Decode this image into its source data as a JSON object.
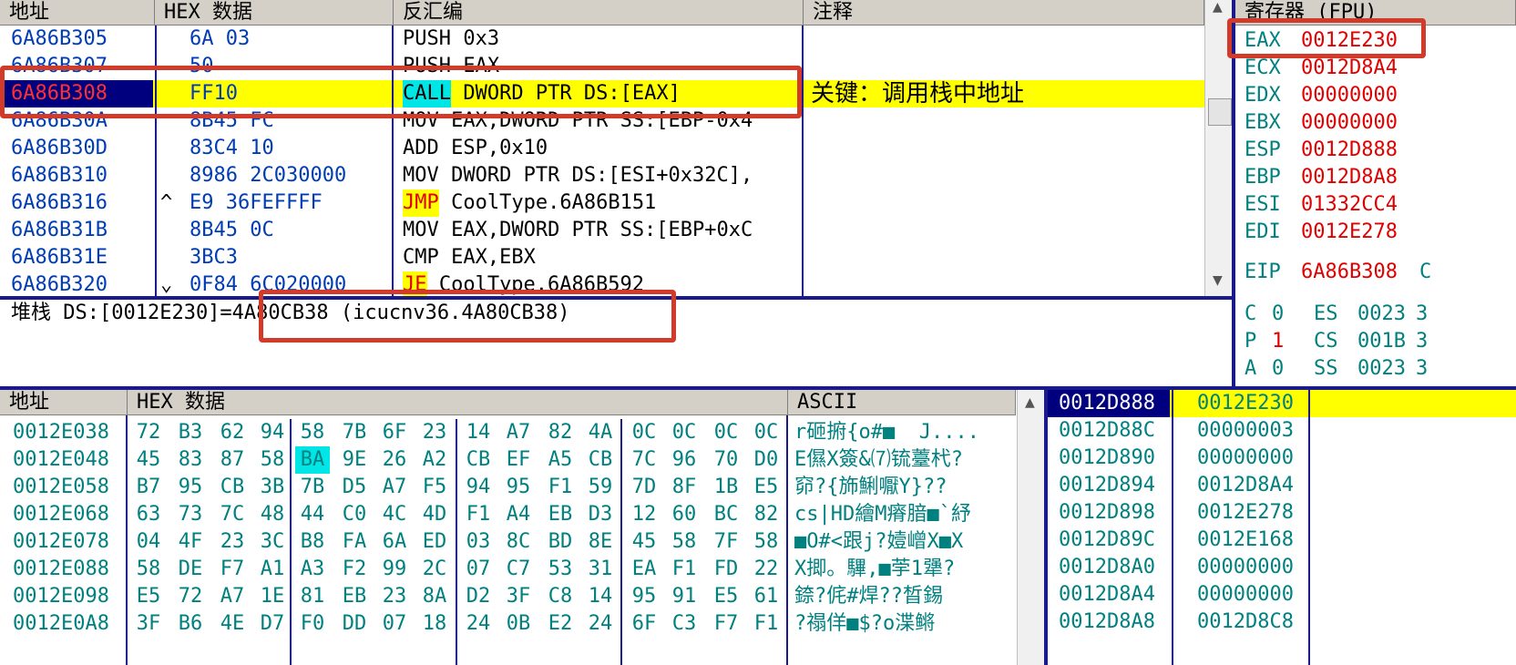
{
  "cpu": {
    "headers": {
      "address": "地址",
      "hex": "HEX 数据",
      "disasm": "反汇编",
      "comment": "注释"
    },
    "rows": [
      {
        "addr": "6A86B305",
        "hex": "6A 03",
        "mnem": "PUSH",
        "ops": " 0x3",
        "comment": ""
      },
      {
        "addr": "6A86B307",
        "hex": "50",
        "mnem": "PUSH",
        "ops": " EAX",
        "comment": ""
      },
      {
        "addr": "6A86B308",
        "hex": "FF10",
        "mnem": "CALL",
        "ops": " DWORD PTR DS:[EAX]",
        "comment": "关键：调用栈中地址"
      },
      {
        "addr": "6A86B30A",
        "hex": "8B45 FC",
        "mnem": "MOV",
        "ops": " EAX,DWORD PTR SS:[EBP-0x4",
        "comment": ""
      },
      {
        "addr": "6A86B30D",
        "hex": "83C4 10",
        "mnem": "ADD",
        "ops": " ESP,0x10",
        "comment": ""
      },
      {
        "addr": "6A86B310",
        "hex": "8986 2C030000",
        "mnem": "MOV",
        "ops": " DWORD PTR DS:[ESI+0x32C],",
        "comment": ""
      },
      {
        "addr": "6A86B316",
        "hex": "E9 36FEFFFF",
        "mnem": "JMP",
        "ops": " CoolType.6A86B151",
        "comment": ""
      },
      {
        "addr": "6A86B31B",
        "hex": "8B45 0C",
        "mnem": "MOV",
        "ops": " EAX,DWORD PTR SS:[EBP+0xC",
        "comment": ""
      },
      {
        "addr": "6A86B31E",
        "hex": "3BC3",
        "mnem": "CMP",
        "ops": " EAX,EBX",
        "comment": ""
      },
      {
        "addr": "6A86B320",
        "hex": "0F84 6C020000",
        "mnem": "JE",
        "ops": " CoolType.6A86B592",
        "comment": ""
      }
    ],
    "jump_marks": {
      "up": "^",
      "down": "⌄"
    },
    "info_line": "堆栈 DS:[0012E230]=4A80CB38 (icucnv36.4A80CB38)"
  },
  "registers": {
    "title": "寄存器 (FPU)",
    "regs": [
      {
        "name": "EAX",
        "value": "0012E230"
      },
      {
        "name": "ECX",
        "value": "0012D8A4"
      },
      {
        "name": "EDX",
        "value": "00000000"
      },
      {
        "name": "EBX",
        "value": "00000000"
      },
      {
        "name": "ESP",
        "value": "0012D888"
      },
      {
        "name": "EBP",
        "value": "0012D8A8"
      },
      {
        "name": "ESI",
        "value": "01332CC4"
      },
      {
        "name": "EDI",
        "value": "0012E278"
      }
    ],
    "eip": {
      "name": "EIP",
      "value": "6A86B308",
      "extra": "C"
    },
    "flags": [
      {
        "flag": "C",
        "val": "0",
        "seg": "ES",
        "segval": "0023",
        "tail": "3"
      },
      {
        "flag": "P",
        "val": "1",
        "seg": "CS",
        "segval": "001B",
        "tail": "3"
      },
      {
        "flag": "A",
        "val": "0",
        "seg": "SS",
        "segval": "0023",
        "tail": "3"
      }
    ]
  },
  "dump": {
    "headers": {
      "address": "地址",
      "hex": "HEX 数据",
      "ascii": "ASCII"
    },
    "rows": [
      {
        "addr": "0012E038",
        "bytes": [
          "72",
          "B3",
          "62",
          "94",
          "58",
          "7B",
          "6F",
          "23",
          "14",
          "A7",
          "82",
          "4A",
          "0C",
          "0C",
          "0C",
          "0C"
        ],
        "ascii": "r砸捬{o#■  J...."
      },
      {
        "addr": "0012E048",
        "bytes": [
          "45",
          "83",
          "87",
          "58",
          "BA",
          "9E",
          "26",
          "A2",
          "CB",
          "EF",
          "A5",
          "CB",
          "7C",
          "96",
          "70",
          "D0"
        ],
        "ascii": "E儑X簽&⑺锍薹杙?"
      },
      {
        "addr": "0012E058",
        "bytes": [
          "B7",
          "95",
          "CB",
          "3B",
          "7B",
          "D5",
          "A7",
          "F5",
          "94",
          "95",
          "F1",
          "59",
          "7D",
          "8F",
          "1B",
          "E5"
        ],
        "ascii": "窌?{斾鯏嚈Y}??"
      },
      {
        "addr": "0012E068",
        "bytes": [
          "63",
          "73",
          "7C",
          "48",
          "44",
          "C0",
          "4C",
          "4D",
          "F1",
          "A4",
          "EB",
          "D3",
          "12",
          "60",
          "BC",
          "82"
        ],
        "ascii": "cs|HD繪M瘠腤■`紓"
      },
      {
        "addr": "0012E078",
        "bytes": [
          "04",
          "4F",
          "23",
          "3C",
          "B8",
          "FA",
          "6A",
          "ED",
          "03",
          "8C",
          "BD",
          "8E",
          "45",
          "58",
          "7F",
          "58"
        ],
        "ascii": "■O#<跟j?嬄嶒X■X"
      },
      {
        "addr": "0012E088",
        "bytes": [
          "58",
          "DE",
          "F7",
          "A1",
          "A3",
          "F2",
          "99",
          "2C",
          "07",
          "C7",
          "53",
          "31",
          "EA",
          "F1",
          "FD",
          "22"
        ],
        "ascii": "X揤。驆,■荢1犟?"
      },
      {
        "addr": "0012E098",
        "bytes": [
          "E5",
          "72",
          "A7",
          "1E",
          "81",
          "EB",
          "23",
          "8A",
          "D2",
          "3F",
          "C8",
          "14",
          "95",
          "91",
          "E5",
          "61"
        ],
        "ascii": "錼?侂#焊??晳錫"
      },
      {
        "addr": "0012E0A8",
        "bytes": [
          "3F",
          "B6",
          "4E",
          "D7",
          "F0",
          "DD",
          "07",
          "18",
          "24",
          "0B",
          "E2",
          "24",
          "6F",
          "C3",
          "F7",
          "F1"
        ],
        "ascii": "?禢佯■$?o渫鳉"
      }
    ]
  },
  "stack": {
    "rows": [
      {
        "addr": "0012D888",
        "value": "0012E230"
      },
      {
        "addr": "0012D88C",
        "value": "00000003"
      },
      {
        "addr": "0012D890",
        "value": "00000000"
      },
      {
        "addr": "0012D894",
        "value": "0012D8A4"
      },
      {
        "addr": "0012D898",
        "value": "0012E278"
      },
      {
        "addr": "0012D89C",
        "value": "0012E168"
      },
      {
        "addr": "0012D8A0",
        "value": "00000000"
      },
      {
        "addr": "0012D8A4",
        "value": "00000000"
      },
      {
        "addr": "0012D8A8",
        "value": "0012D8C8"
      }
    ]
  },
  "colors": {
    "highlight": "#ffff00",
    "selection": "#00007f",
    "cyan": "#00e6e6",
    "annotation": "#d23a2a"
  }
}
